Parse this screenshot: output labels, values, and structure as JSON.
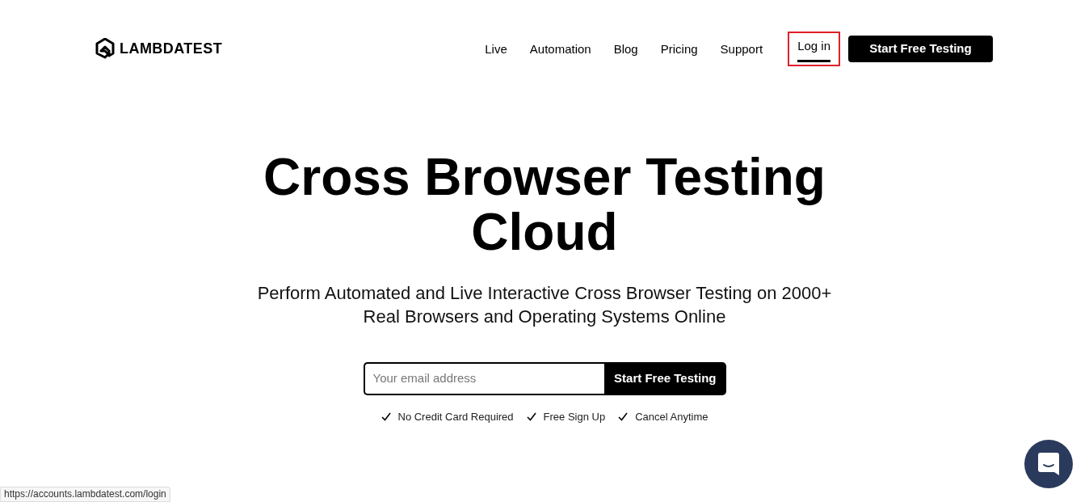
{
  "logo": {
    "text": "LAMBDATEST"
  },
  "nav": [
    {
      "label": "Live",
      "selected": false
    },
    {
      "label": "Automation",
      "selected": false
    },
    {
      "label": "Blog",
      "selected": false
    },
    {
      "label": "Pricing",
      "selected": false
    },
    {
      "label": "Support",
      "selected": false
    },
    {
      "label": "Log in",
      "selected": true
    }
  ],
  "header_button": "Start Free Testing",
  "hero": {
    "title": "Cross Browser Testing Cloud",
    "subtitle": "Perform Automated and Live Interactive Cross Browser Testing on 2000+ Real Browsers and Operating Systems Online"
  },
  "signup": {
    "placeholder": "Your email address",
    "button": "Start Free Testing"
  },
  "perks": [
    "No Credit Card Required",
    "Free Sign Up",
    "Cancel Anytime"
  ],
  "status_bar": {
    "url": "https://accounts.lambdatest.com/login"
  }
}
